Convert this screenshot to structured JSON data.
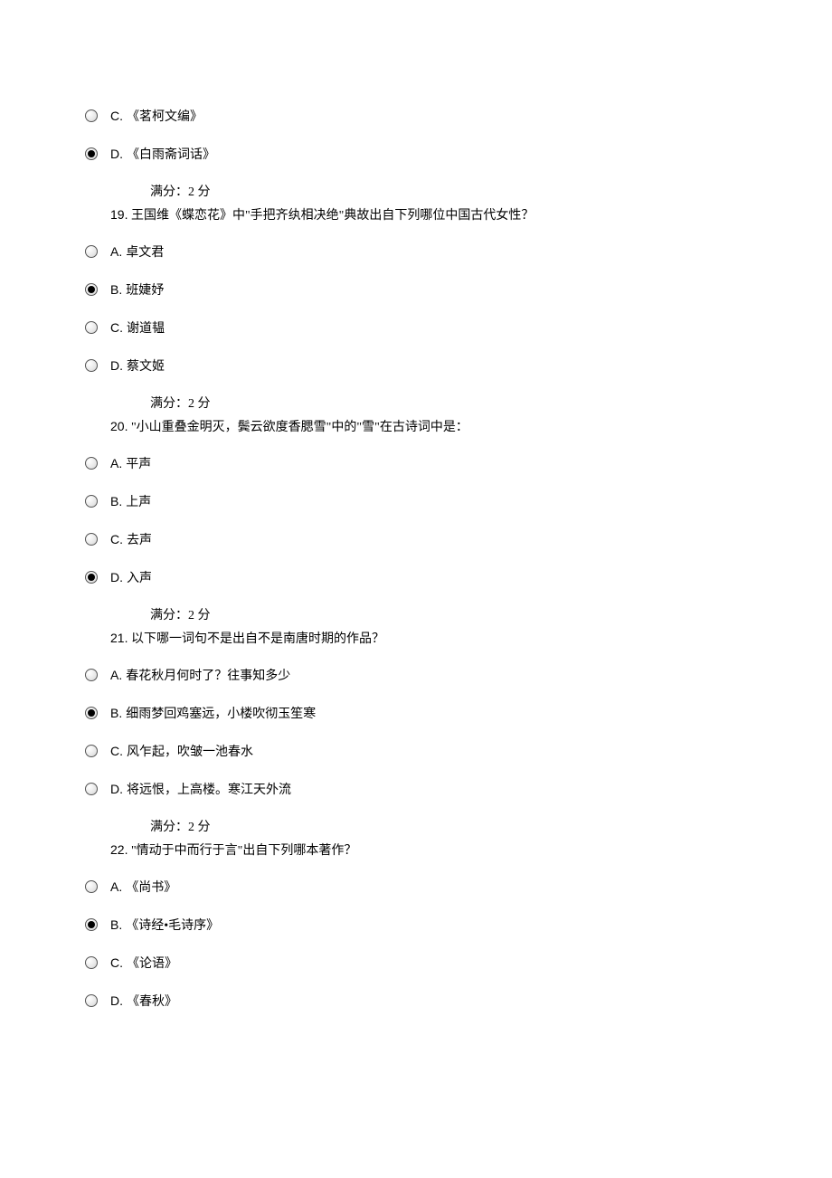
{
  "leading_options": [
    {
      "letter": "C.",
      "text": "《茗柯文编》",
      "checked": false
    },
    {
      "letter": "D.",
      "text": "《白雨斋词话》",
      "checked": true
    }
  ],
  "questions": [
    {
      "score": "满分：2 分",
      "num": "19.",
      "text": " 王国维《蝶恋花》中\"手把齐纨相决绝\"典故出自下列哪位中国古代女性？",
      "options": [
        {
          "letter": "A.",
          "text": "卓文君",
          "checked": false
        },
        {
          "letter": "B.",
          "text": "班婕妤",
          "checked": true
        },
        {
          "letter": "C.",
          "text": "谢道韫",
          "checked": false
        },
        {
          "letter": "D.",
          "text": "蔡文姬",
          "checked": false
        }
      ]
    },
    {
      "score": "满分：2 分",
      "num": "20.",
      "text": " \"小山重叠金明灭，鬓云欲度香腮雪\"中的\"雪\"在古诗词中是：",
      "options": [
        {
          "letter": "A.",
          "text": "平声",
          "checked": false
        },
        {
          "letter": "B.",
          "text": "上声",
          "checked": false
        },
        {
          "letter": "C.",
          "text": "去声",
          "checked": false
        },
        {
          "letter": "D.",
          "text": "入声",
          "checked": true
        }
      ]
    },
    {
      "score": "满分：2 分",
      "num": "21.",
      "text": " 以下哪一词句不是出自不是南唐时期的作品？",
      "options": [
        {
          "letter": "A.",
          "text": "春花秋月何时了？往事知多少",
          "checked": false
        },
        {
          "letter": "B.",
          "text": "细雨梦回鸡塞远，小楼吹彻玉笙寒",
          "checked": true
        },
        {
          "letter": "C.",
          "text": "风乍起，吹皱一池春水",
          "checked": false
        },
        {
          "letter": "D.",
          "text": "将远恨，上高楼。寒江天外流",
          "checked": false
        }
      ]
    },
    {
      "score": "满分：2 分",
      "num": "22.",
      "text": " \"情动于中而行于言\"出自下列哪本著作？",
      "options": [
        {
          "letter": "A.",
          "text": "《尚书》",
          "checked": false
        },
        {
          "letter": "B.",
          "text": "《诗经•毛诗序》",
          "checked": true
        },
        {
          "letter": "C.",
          "text": "《论语》",
          "checked": false
        },
        {
          "letter": "D.",
          "text": "《春秋》",
          "checked": false
        }
      ]
    }
  ]
}
